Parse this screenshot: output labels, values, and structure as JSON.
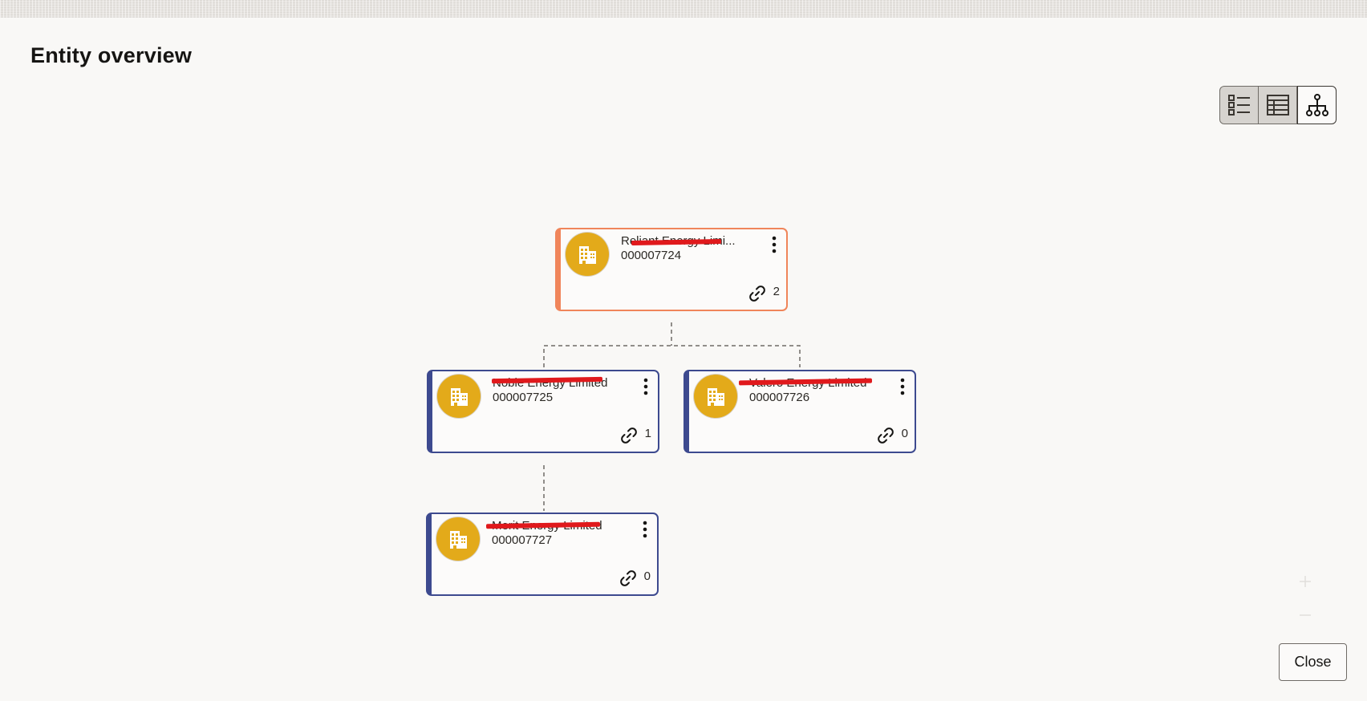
{
  "dialog": {
    "title": "Entity overview",
    "close_label": "Close"
  },
  "view_switcher": {
    "options": [
      {
        "name": "list-view",
        "icon": "list-icon",
        "selected": false
      },
      {
        "name": "table-view",
        "icon": "table-icon",
        "selected": false
      },
      {
        "name": "hierarchy-view",
        "icon": "hierarchy-icon",
        "selected": true
      }
    ]
  },
  "entities": [
    {
      "name": "Reliant Energy Limi...",
      "id": "000007724",
      "links": "2",
      "role": "parent",
      "name_redacted": true
    },
    {
      "name": "Noble Energy Limited",
      "id": "000007725",
      "links": "1",
      "role": "child",
      "name_redacted": true
    },
    {
      "name": "Valero Energy Limited",
      "id": "000007726",
      "links": "0",
      "role": "child",
      "name_redacted": true
    },
    {
      "name": "Merit Energy Limited",
      "id": "000007727",
      "links": "0",
      "role": "child",
      "name_redacted": true
    }
  ],
  "icons": {
    "avatar": "building-icon",
    "menu": "more-vertical-icon",
    "links": "link-icon"
  },
  "colors": {
    "root_border": "#f0855a",
    "child_border": "#3d4a8f",
    "avatar": "#e3aa1a",
    "redaction": "#e0191c"
  }
}
